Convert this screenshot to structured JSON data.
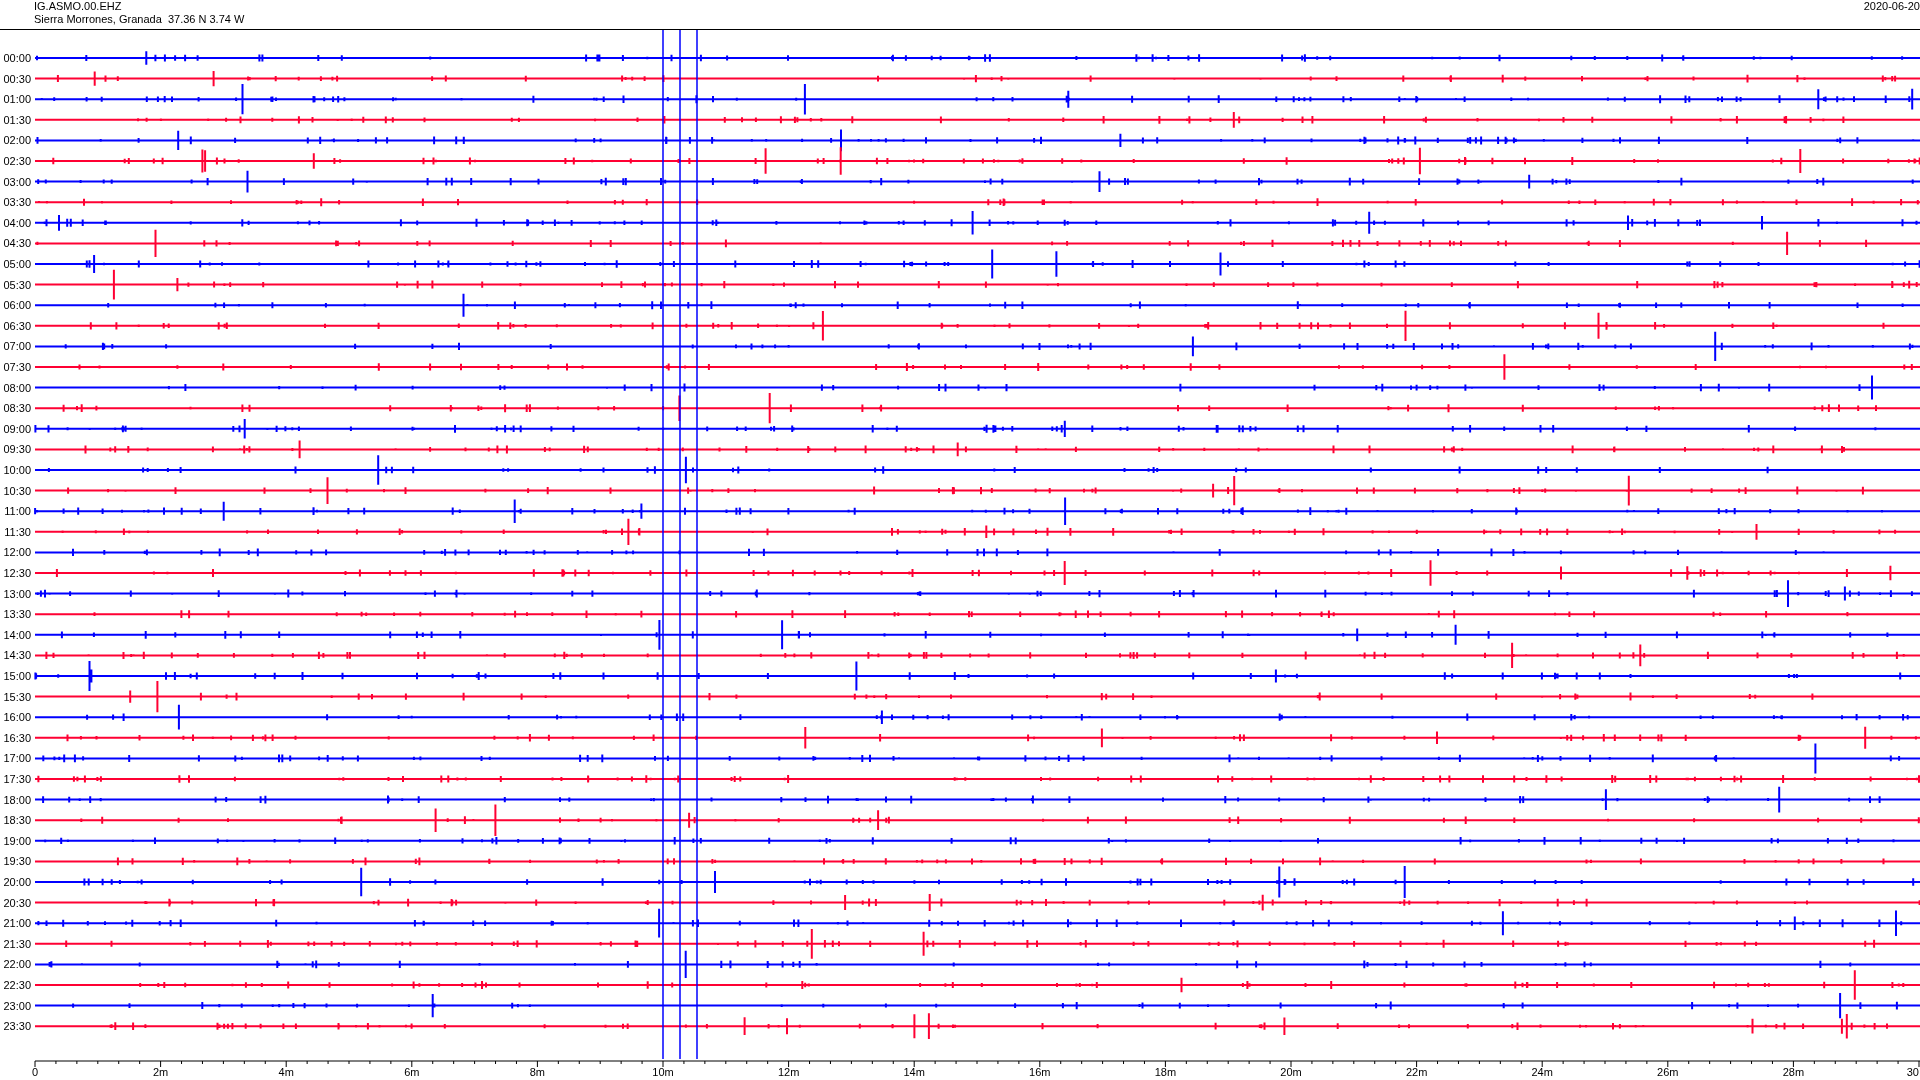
{
  "header": {
    "station": "IG.ASMO.00.EHZ",
    "location": "Sierra Morrones, Granada  37.36 N 3.74 W",
    "date": "2020-06-20"
  },
  "traces": [
    {
      "label": "00:00",
      "color": "#0000ff"
    },
    {
      "label": "00:30",
      "color": "#ff0033"
    },
    {
      "label": "01:00",
      "color": "#0000ff"
    },
    {
      "label": "01:30",
      "color": "#ff0033"
    },
    {
      "label": "02:00",
      "color": "#0000ff"
    },
    {
      "label": "02:30",
      "color": "#ff0033"
    },
    {
      "label": "03:00",
      "color": "#0000ff"
    },
    {
      "label": "03:30",
      "color": "#ff0033"
    },
    {
      "label": "04:00",
      "color": "#0000ff"
    },
    {
      "label": "04:30",
      "color": "#ff0033"
    },
    {
      "label": "05:00",
      "color": "#0000ff"
    },
    {
      "label": "05:30",
      "color": "#ff0033"
    },
    {
      "label": "06:00",
      "color": "#0000ff"
    },
    {
      "label": "06:30",
      "color": "#ff0033"
    },
    {
      "label": "07:00",
      "color": "#0000ff"
    },
    {
      "label": "07:30",
      "color": "#ff0033"
    },
    {
      "label": "08:00",
      "color": "#0000ff"
    },
    {
      "label": "08:30",
      "color": "#ff0033"
    },
    {
      "label": "09:00",
      "color": "#0000ff"
    },
    {
      "label": "09:30",
      "color": "#ff0033"
    },
    {
      "label": "10:00",
      "color": "#0000ff"
    },
    {
      "label": "10:30",
      "color": "#ff0033"
    },
    {
      "label": "11:00",
      "color": "#0000ff"
    },
    {
      "label": "11:30",
      "color": "#ff0033"
    },
    {
      "label": "12:00",
      "color": "#0000ff"
    },
    {
      "label": "12:30",
      "color": "#ff0033"
    },
    {
      "label": "13:00",
      "color": "#0000ff"
    },
    {
      "label": "13:30",
      "color": "#ff0033"
    },
    {
      "label": "14:00",
      "color": "#0000ff"
    },
    {
      "label": "14:30",
      "color": "#ff0033"
    },
    {
      "label": "15:00",
      "color": "#0000ff"
    },
    {
      "label": "15:30",
      "color": "#ff0033"
    },
    {
      "label": "16:00",
      "color": "#0000ff"
    },
    {
      "label": "16:30",
      "color": "#ff0033"
    },
    {
      "label": "17:00",
      "color": "#0000ff"
    },
    {
      "label": "17:30",
      "color": "#ff0033"
    },
    {
      "label": "18:00",
      "color": "#0000ff"
    },
    {
      "label": "18:30",
      "color": "#ff0033"
    },
    {
      "label": "19:00",
      "color": "#0000ff"
    },
    {
      "label": "19:30",
      "color": "#ff0033"
    },
    {
      "label": "20:00",
      "color": "#0000ff"
    },
    {
      "label": "20:30",
      "color": "#ff0033"
    },
    {
      "label": "21:00",
      "color": "#0000ff"
    },
    {
      "label": "21:30",
      "color": "#ff0033"
    },
    {
      "label": "22:00",
      "color": "#0000ff"
    },
    {
      "label": "22:30",
      "color": "#ff0033"
    },
    {
      "label": "23:00",
      "color": "#0000ff"
    },
    {
      "label": "23:30",
      "color": "#ff0033"
    }
  ],
  "x_axis": {
    "labels": [
      "0",
      "2m",
      "4m",
      "6m",
      "8m",
      "10m",
      "12m",
      "14m",
      "16m",
      "18m",
      "20m",
      "22m",
      "24m",
      "26m",
      "28m",
      "30"
    ]
  }
}
